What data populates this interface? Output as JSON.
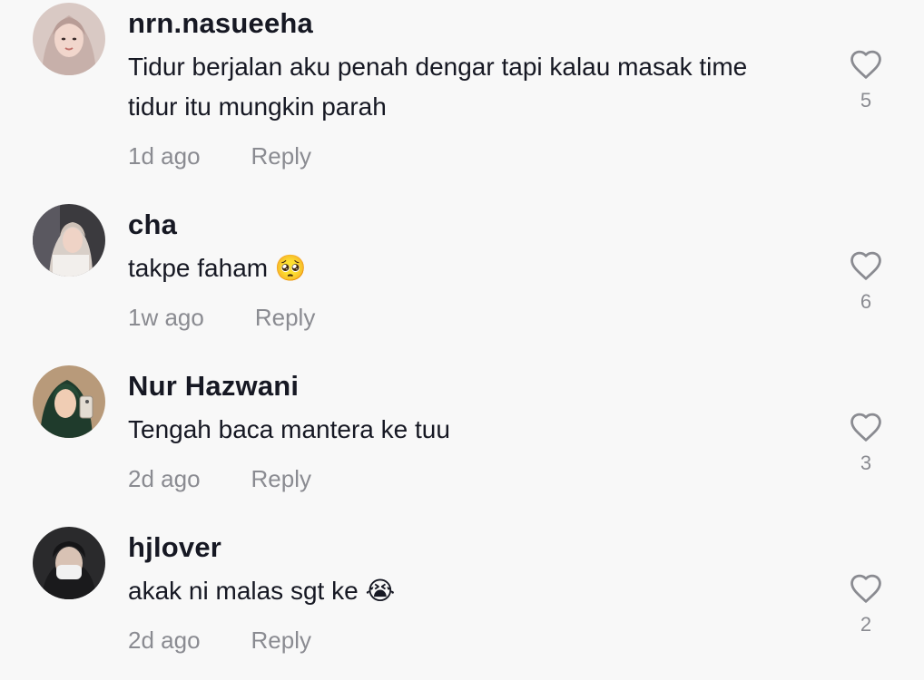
{
  "comments": [
    {
      "username": "nrn.nasueeha",
      "text": "Tidur berjalan aku penah dengar tapi kalau masak time tidur itu mungkin parah",
      "time": "1d ago",
      "reply_label": "Reply",
      "likes": "5",
      "like_icon": "heart-outline-icon"
    },
    {
      "username": "cha",
      "text": "takpe faham 🥺",
      "time": "1w ago",
      "reply_label": "Reply",
      "likes": "6",
      "like_icon": "heart-outline-icon"
    },
    {
      "username": "Nur Hazwani",
      "text": "Tengah baca mantera ke tuu ",
      "time": "2d ago",
      "reply_label": "Reply",
      "likes": "3",
      "like_icon": "heart-outline-icon"
    },
    {
      "username": "hjlover",
      "text": "akak ni malas sgt ke 😭",
      "time": "2d ago",
      "reply_label": "Reply",
      "likes": "2",
      "like_icon": "heart-outline-icon"
    }
  ],
  "colors": {
    "background": "#f8f8f8",
    "username": "#161823",
    "muted": "#8a8b91"
  }
}
